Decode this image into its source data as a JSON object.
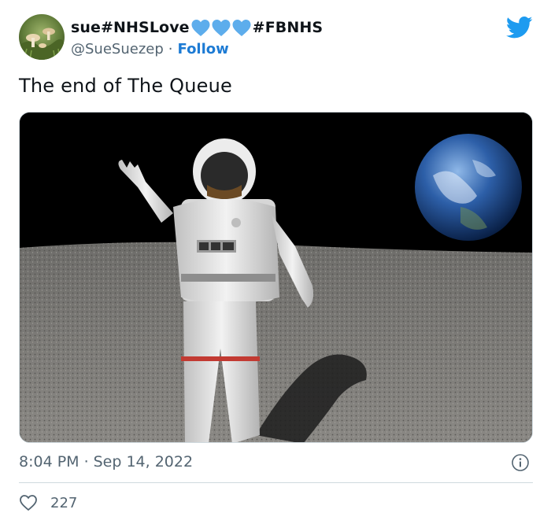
{
  "author": {
    "name_prefix": "sue#NHSLove",
    "name_suffix": "#FBNHS",
    "name_emoji_icons": [
      "blue-heart-icon",
      "blue-heart-icon",
      "blue-heart-icon"
    ],
    "handle": "@SueSuezep",
    "separator": "·",
    "follow_label": "Follow"
  },
  "tweet": {
    "text": "The end of The Queue",
    "time": "8:04 PM",
    "separator": "·",
    "date": "Sep 14, 2022"
  },
  "engagement": {
    "likes": "227"
  },
  "icons": {
    "brand": "twitter-bird-icon",
    "info": "info-icon",
    "like": "heart-outline-icon"
  },
  "colors": {
    "brand_blue": "#1d9bf0",
    "follow_blue": "#1d7bd4",
    "text_primary": "#0f1419",
    "text_secondary": "#536471",
    "divider": "#cfd9de"
  }
}
